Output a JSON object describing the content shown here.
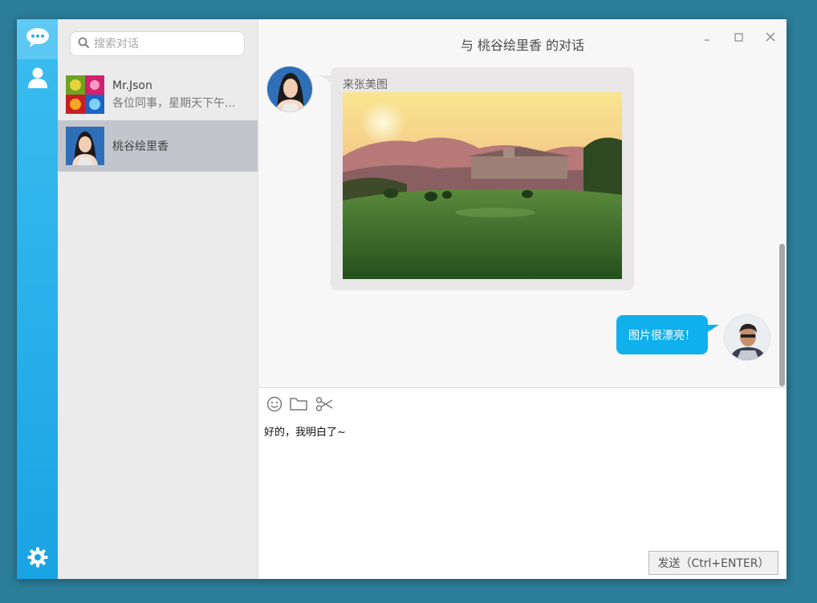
{
  "sidebar": {
    "nav": [
      {
        "icon": "chat-bubble-icon",
        "active": true
      },
      {
        "icon": "contacts-icon",
        "active": false
      }
    ],
    "settings_icon": "gear-icon",
    "search_placeholder": "搜索对话",
    "conversations": [
      {
        "name": "Mr.Json",
        "preview": "各位同事，星期天下午...",
        "active": false
      },
      {
        "name": "桃谷绘里香",
        "preview": "",
        "active": true
      }
    ]
  },
  "chat": {
    "title": "与 桃谷绘里香 的对话",
    "messages": [
      {
        "direction": "in",
        "caption": "来张美图",
        "image": "golf-course-sunset-photo"
      },
      {
        "direction": "out",
        "text": "图片很漂亮！"
      }
    ]
  },
  "window_controls": {
    "minimize": "minimize-icon",
    "maximize": "maximize-icon",
    "close": "close-icon"
  },
  "composer": {
    "tools": [
      "emoji-icon",
      "folder-icon",
      "scissors-icon"
    ],
    "text": "好的，我明白了~",
    "send_label": "发送（Ctrl+ENTER）"
  },
  "colors": {
    "accent": "#10b0ec",
    "desktop": "#2c7d9a",
    "iconbar": "#1aa3e3"
  }
}
